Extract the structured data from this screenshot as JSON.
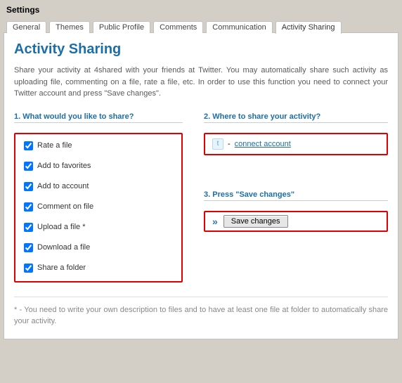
{
  "page": {
    "title": "Settings"
  },
  "tabs": {
    "items": [
      {
        "label": "General"
      },
      {
        "label": "Themes"
      },
      {
        "label": "Public Profile"
      },
      {
        "label": "Comments"
      },
      {
        "label": "Communication"
      },
      {
        "label": "Activity Sharing"
      }
    ]
  },
  "heading": "Activity Sharing",
  "description": "Share your activity at 4shared with your friends at Twitter. You may automatically share such activity as uploading file, commenting on a file, rate a file, etc. In order to use this function you need to connect your Twitter account and press \"Save changes\".",
  "section1": {
    "title": "1. What would you like to share?",
    "items": [
      {
        "label": "Rate a file"
      },
      {
        "label": "Add to favorites"
      },
      {
        "label": "Add to account"
      },
      {
        "label": "Comment on file"
      },
      {
        "label": "Upload a file *"
      },
      {
        "label": "Download a file"
      },
      {
        "label": "Share a folder"
      }
    ]
  },
  "section2": {
    "title": "2. Where to share your activity?",
    "dash": "-",
    "link": "connect account"
  },
  "section3": {
    "title": "3. Press \"Save changes\"",
    "arrows": "»",
    "button": "Save changes"
  },
  "footnote": "* - You need to write your own description to files and to have at least one file at folder to automatically share your activity."
}
